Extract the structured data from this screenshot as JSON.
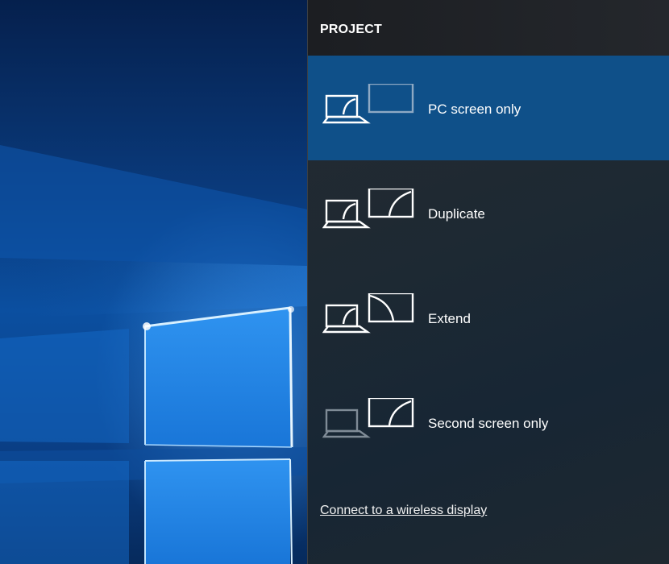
{
  "panel": {
    "title": "PROJECT",
    "options": [
      {
        "label": "PC screen only",
        "selected": true,
        "icons": [
          "laptop-icon",
          "monitor-icon"
        ]
      },
      {
        "label": "Duplicate",
        "selected": false,
        "icons": [
          "laptop-icon",
          "monitor-icon"
        ]
      },
      {
        "label": "Extend",
        "selected": false,
        "icons": [
          "laptop-icon",
          "monitor-icon"
        ]
      },
      {
        "label": "Second screen only",
        "selected": false,
        "icons": [
          "laptop-icon",
          "monitor-icon"
        ]
      }
    ],
    "connect_link": "Connect to a wireless display"
  },
  "colors": {
    "selected_background": "#0f5089",
    "panel_background": "#1d2933",
    "text": "#ffffff",
    "dimmed_icon": "#8e9aa6"
  }
}
